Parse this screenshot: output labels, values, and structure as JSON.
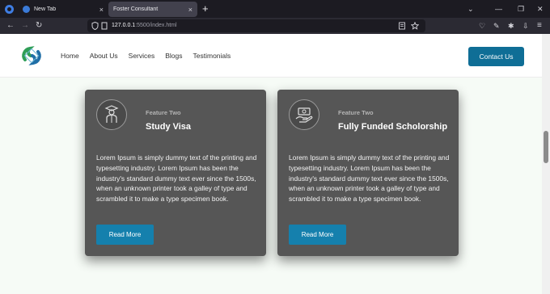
{
  "browser": {
    "tabs": [
      {
        "title": "New Tab",
        "close": "×"
      },
      {
        "title": "Foster Consultant",
        "close": "×"
      }
    ],
    "new_tab": "+",
    "url_host": "127.0.0.1",
    "url_rest": ":5500/index.html",
    "window_controls": [
      "⌄",
      "—",
      "❐",
      "✕"
    ]
  },
  "site": {
    "nav": [
      "Home",
      "About Us",
      "Services",
      "Blogs",
      "Testimonials"
    ],
    "cta": "Contact Us"
  },
  "cards": [
    {
      "kicker": "Feature Two",
      "title": "Study Visa",
      "icon": "graduate-icon",
      "body": "Lorem Ipsum is simply dummy text of the printing and typesetting industry. Lorem Ipsum has been the industry's standard dummy text ever since the 1500s, when an unknown printer took a galley of type and scrambled it to make a type specimen book.",
      "button": "Read More"
    },
    {
      "kicker": "Feature Two",
      "title": "Fully Funded Scholorship",
      "icon": "money-hand-icon",
      "body": "Lorem Ipsum is simply dummy text of the printing and typesetting industry. Lorem Ipsum has been the industry's standard dummy text ever since the 1500s, when an unknown printer took a galley of type and scrambled it to make a type specimen book.",
      "button": "Read More"
    }
  ],
  "colors": {
    "brand": "#0f6e96",
    "button": "#1580ad",
    "card_bg": "#565656"
  }
}
